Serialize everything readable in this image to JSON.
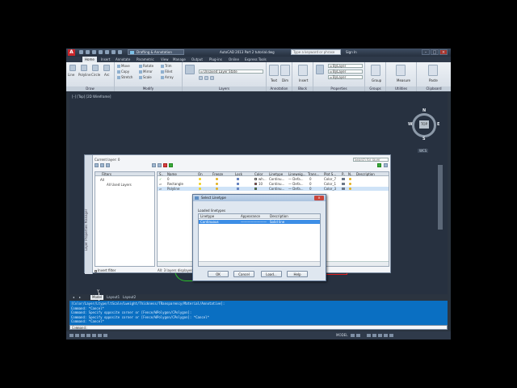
{
  "app": {
    "logo": "A",
    "workspace": "Drafting & Annotation",
    "window_title": "AutoCAD 2013   Part 2 tutorial.dwg",
    "search_placeholder": "Type a keyword or phrase",
    "sign_in": "Sign In",
    "min": "–",
    "max": "□",
    "close": "×"
  },
  "tabs": [
    "Home",
    "Insert",
    "Annotate",
    "Parametric",
    "View",
    "Manage",
    "Output",
    "Plug-ins",
    "Online",
    "Express Tools"
  ],
  "active_tab": "Home",
  "ribbon": {
    "draw": {
      "label": "Draw",
      "buttons": [
        "Line",
        "Polyline",
        "Circle",
        "Arc"
      ]
    },
    "modify": {
      "label": "Modify",
      "rows": [
        [
          "Move",
          "Rotate",
          "Trim"
        ],
        [
          "Copy",
          "Mirror",
          "Fillet"
        ],
        [
          "Stretch",
          "Scale",
          "Array"
        ]
      ]
    },
    "layers": {
      "label": "Layers",
      "combo": "Unsaved Layer State"
    },
    "annotation": {
      "label": "Annotation",
      "buttons": [
        "Text",
        "Dim"
      ]
    },
    "block": {
      "label": "Block",
      "buttons": [
        "Insert"
      ]
    },
    "properties": {
      "label": "Properties",
      "combos": [
        "ByLayer",
        "ByLayer",
        "ByLayer"
      ]
    },
    "groups": {
      "label": "Groups",
      "buttons": [
        "Group"
      ]
    },
    "utilities": {
      "label": "Utilities",
      "buttons": [
        "Measure"
      ]
    },
    "clipboard": {
      "label": "Clipboard",
      "buttons": [
        "Paste"
      ]
    }
  },
  "viewport_label": "[–] [Top] [2D Wireframe]",
  "viewcube": {
    "top": "TOP",
    "n": "N",
    "s": "S",
    "e": "E",
    "w": "W",
    "wcs": "WCS"
  },
  "ucs": {
    "x": "X",
    "y": "Y"
  },
  "layer_manager": {
    "side_label": "Layer Properties Manager",
    "current_layer": "Current layer: 0",
    "search_placeholder": "Search for layer",
    "filters_header": "Filters",
    "filter_tree": [
      "All",
      "All Used Layers"
    ],
    "invert_filter": "Invert filter",
    "status": "All: 3 layers displayed of 3 total layers",
    "columns": [
      "S..",
      "Name",
      "On",
      "Freeze",
      "Lock",
      "Color",
      "Linetype",
      "Lineweig...",
      "Trans...",
      "Plot S...",
      "P..",
      "N..",
      "Description"
    ],
    "layers": [
      {
        "status": "✓",
        "name": "0",
        "color": "wh...",
        "linetype": "Continu...",
        "lineweight": "— Defa...",
        "transparency": "0",
        "plot_style": "Color_7"
      },
      {
        "status": "▱",
        "name": "Rectangle",
        "color": "10",
        "linetype": "Continu...",
        "lineweight": "— Defa...",
        "transparency": "0",
        "plot_style": "Color_1"
      },
      {
        "status": "▱",
        "name": "Polyline",
        "color": "",
        "linetype": "Continu...",
        "lineweight": "— Defa...",
        "transparency": "0",
        "plot_style": "Color_3"
      }
    ],
    "swatch_colors": [
      "#ffffff",
      "#e83030",
      "#2fc42f"
    ]
  },
  "dialog": {
    "title": "Select Linetype",
    "close": "×",
    "loaded_label": "Loaded linetypes",
    "columns": [
      "Linetype",
      "Appearance",
      "Description"
    ],
    "row": {
      "linetype": "Continuous",
      "appearance": "————————",
      "description": "Solid line"
    },
    "buttons": {
      "ok": "OK",
      "cancel": "Cancel",
      "load": "Load...",
      "help": "Help"
    }
  },
  "layout_tabs": [
    "Model",
    "Layout1",
    "Layout2"
  ],
  "active_layout": "Model",
  "command_history": [
    "[Color/Layer/Ltype/ltScale/Lweight/Thickness/TRansparency/Material/Annotative]:",
    "Command: *Cancel*",
    "Command: Specify opposite corner or [Fence/WPolygon/CPolygon]:",
    "Command: Specify opposite corner or [Fence/WPolygon/CPolygon]: *Cancel*",
    "Command: *Cancel*"
  ],
  "command_prompt": "Command:",
  "status_model": "MODEL",
  "colors": {
    "accent": "#0a6fc2",
    "selection": "#3d8ee6"
  }
}
